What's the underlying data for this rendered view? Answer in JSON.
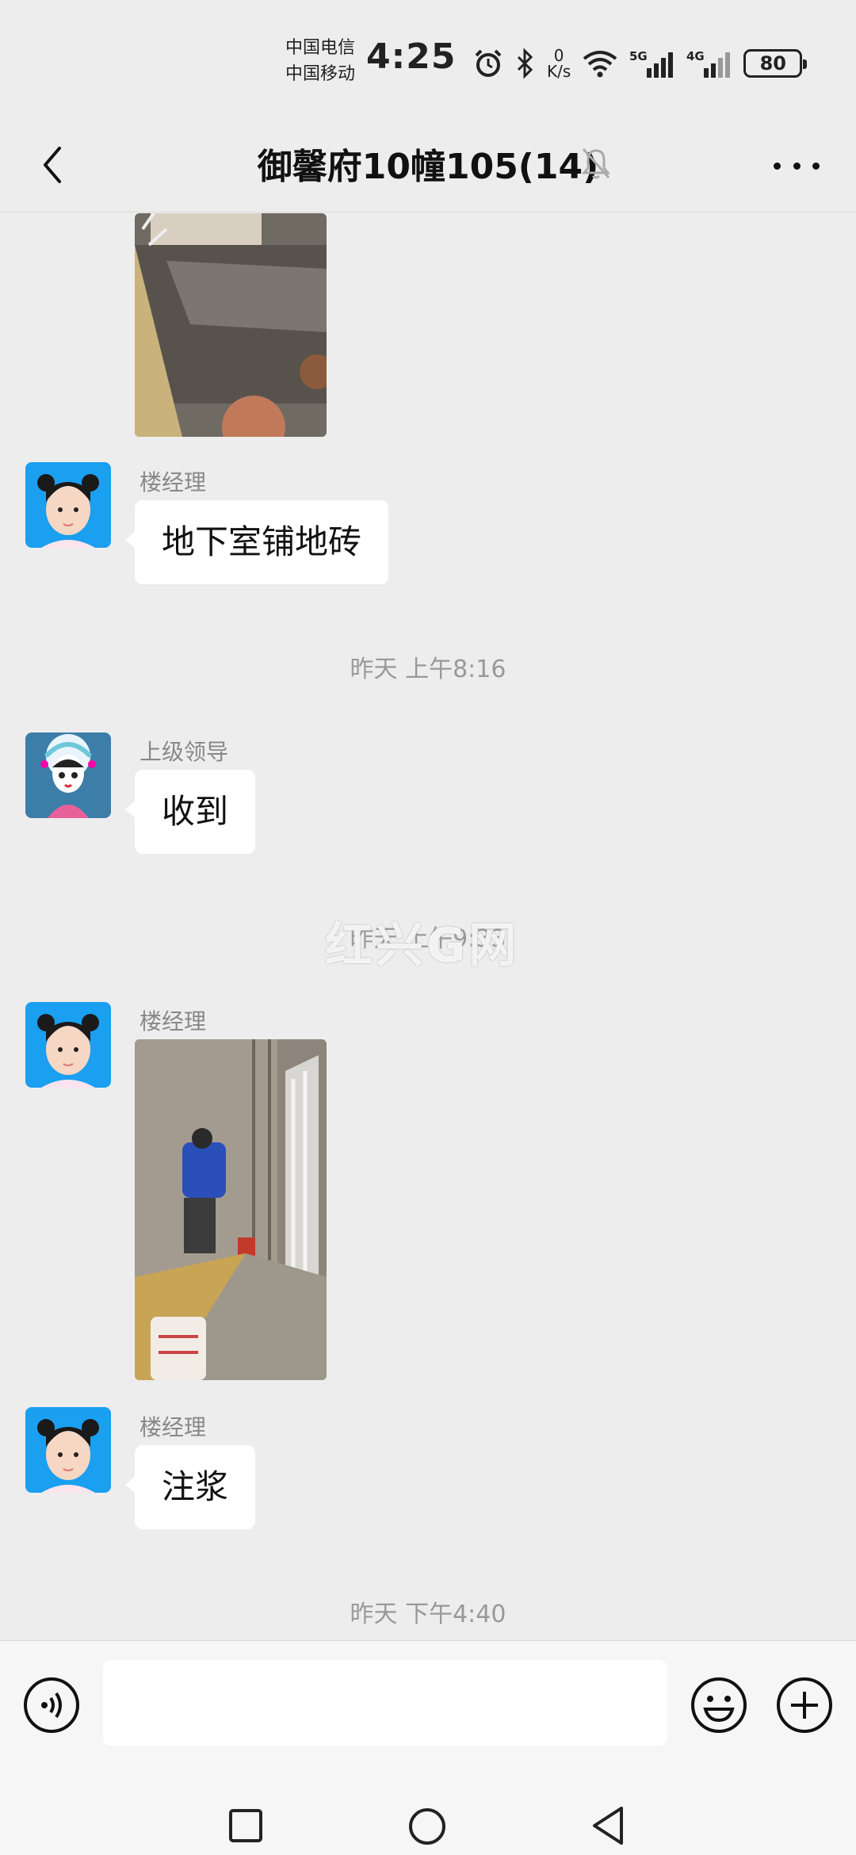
{
  "status_bar": {
    "carrier_1": "中国电信",
    "carrier_2": "中国移动",
    "time": "4:25",
    "net_speed_value": "0",
    "net_speed_unit": "K/s",
    "signal_1_label": "5G",
    "signal_2_label": "4G",
    "battery": "80",
    "icons": [
      "alarm-icon",
      "bluetooth-icon",
      "wifi-icon",
      "signal-5g-icon",
      "signal-4g-icon",
      "battery-icon"
    ]
  },
  "header": {
    "title": "御馨府10幢105(14)",
    "icons": [
      "back-icon",
      "mute-bell-icon",
      "more-icon"
    ]
  },
  "messages": [
    {
      "type": "image",
      "description_icon": "photo"
    },
    {
      "type": "text",
      "sender": "楼经理",
      "text": "地下室铺地砖"
    },
    {
      "type": "time",
      "text": "昨天 上午8:16"
    },
    {
      "type": "text",
      "sender": "上级领导",
      "text": "收到"
    },
    {
      "type": "time",
      "text": "昨天 上午9:33"
    },
    {
      "type": "image",
      "sender": "楼经理"
    },
    {
      "type": "text",
      "sender": "楼经理",
      "text": "注浆"
    },
    {
      "type": "time",
      "text": "昨天 下午4:40"
    }
  ],
  "watermark": "红兴G网",
  "input_bar": {
    "placeholder": "",
    "icons": [
      "voice-icon",
      "emoji-icon",
      "plus-icon"
    ]
  },
  "nav_bar": {
    "icons": [
      "recent-apps-icon",
      "home-icon",
      "nav-back-icon"
    ]
  },
  "colors": {
    "background": "#ededed",
    "bubble": "#ffffff",
    "sender_name": "#888888",
    "timestamp": "#999999"
  }
}
